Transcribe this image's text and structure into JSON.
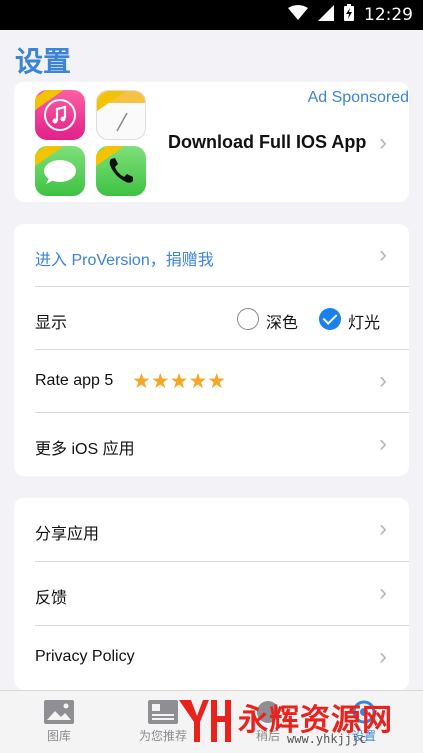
{
  "status_bar": {
    "time": "12:29"
  },
  "page": {
    "title": "设置"
  },
  "ad": {
    "label": "Ad Sponsored",
    "text": "Download Full IOS App",
    "icons": [
      "music-app-icon",
      "notes-app-icon",
      "messages-app-icon",
      "phone-app-icon"
    ]
  },
  "section1": {
    "pro": "进入 ProVersion，捐赠我",
    "display": {
      "label": "显示",
      "options": [
        "深色",
        "灯光"
      ],
      "selected": "灯光"
    },
    "rate": {
      "label": "Rate app 5",
      "stars": "★★★★★"
    },
    "more": "更多 iOS 应用"
  },
  "section2": {
    "share": "分享应用",
    "feedback": "反馈",
    "privacy": "Privacy Policy"
  },
  "tabbar": {
    "tabs": [
      {
        "label": "图库"
      },
      {
        "label": "为您推荐"
      },
      {
        "label": "稍后"
      },
      {
        "label": "设置"
      }
    ]
  },
  "watermark": {
    "text": "永辉资源网",
    "url": "www.yhkjjjc"
  },
  "colors": {
    "accent": "#3c84d6",
    "radio_checked": "#1a7ff0",
    "star": "#f5a623"
  }
}
